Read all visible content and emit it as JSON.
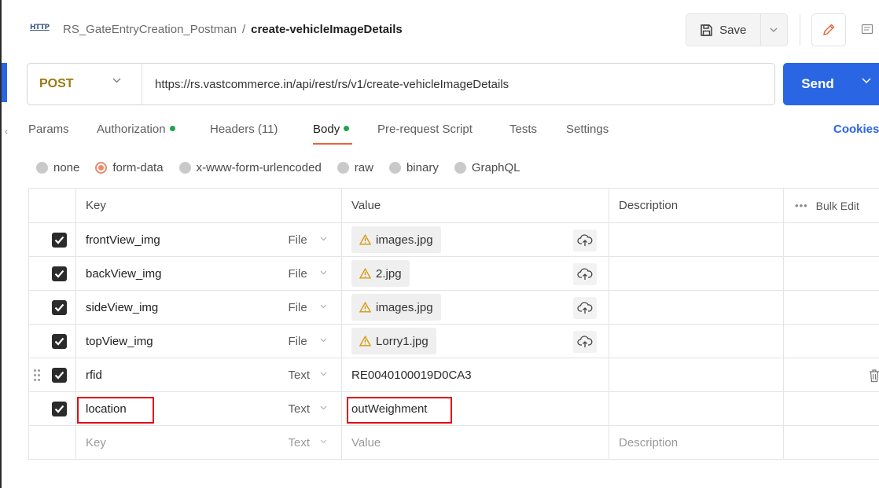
{
  "header": {
    "http_badge": "HTTP",
    "collection": "RS_GateEntryCreation_Postman",
    "separator": "/",
    "request_name": "create-vehicleImageDetails",
    "save_label": "Save"
  },
  "request": {
    "method": "POST",
    "url": "https://rs.vastcommerce.in/api/rest/rs/v1/create-vehicleImageDetails",
    "send_label": "Send"
  },
  "tabs": {
    "params": "Params",
    "authorization": "Authorization",
    "headers": "Headers (11)",
    "body": "Body",
    "pre_request": "Pre-request Script",
    "tests": "Tests",
    "settings": "Settings",
    "cookies": "Cookies",
    "active": "Body",
    "dot_color": "#1fa34a"
  },
  "body_types": {
    "none": "none",
    "form_data": "form-data",
    "urlencoded": "x-www-form-urlencoded",
    "raw": "raw",
    "binary": "binary",
    "graphql": "GraphQL",
    "selected": "form-data"
  },
  "table": {
    "headers": {
      "key": "Key",
      "value": "Value",
      "description": "Description",
      "bulk_edit": "Bulk Edit"
    },
    "rows": [
      {
        "key": "frontView_img",
        "type": "File",
        "value": "images.jpg",
        "checked": true
      },
      {
        "key": "backView_img",
        "type": "File",
        "value": "2.jpg",
        "checked": true
      },
      {
        "key": "sideView_img",
        "type": "File",
        "value": "images.jpg",
        "checked": true
      },
      {
        "key": "topView_img",
        "type": "File",
        "value": "Lorry1.jpg",
        "checked": true
      },
      {
        "key": "rfid",
        "type": "Text",
        "value": "RE0040100019D0CA3",
        "checked": true
      },
      {
        "key": "location",
        "type": "Text",
        "value": "outWeighment",
        "checked": true
      }
    ],
    "empty_row": {
      "key_placeholder": "Key",
      "type": "Text",
      "value_placeholder": "Value",
      "description_placeholder": "Description"
    }
  },
  "colors": {
    "accent_blue": "#2a66e3",
    "method_color": "#9a7a12",
    "highlight_red": "#e00b12",
    "active_tab_underline": "#e8643b"
  }
}
